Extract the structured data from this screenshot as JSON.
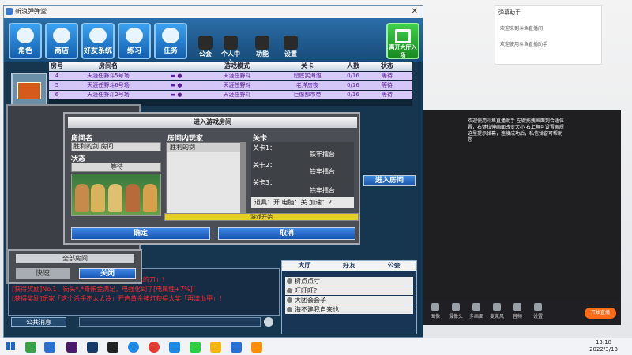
{
  "window": {
    "title": "新浪弹弹堂"
  },
  "toolbar": {
    "character": "角色",
    "shop": "商店",
    "friends": "好友系统",
    "practice": "练习",
    "tasks": "任务",
    "guild": "公会",
    "personal": "个人中心",
    "features": "功能",
    "settings": "设置",
    "exit": "离开大厅入场"
  },
  "room_list": {
    "headers": [
      "房号",
      "房间名",
      "游戏模式",
      "关卡",
      "人数",
      "状态"
    ],
    "rows": [
      {
        "no": "4",
        "name": "天涯任野斗5号场",
        "mode": "天涯任野斗",
        "stage": "窟底实海滩",
        "count": "0/16",
        "status": "等待"
      },
      {
        "no": "5",
        "name": "天涯任野斗6号场",
        "mode": "天涯任野斗",
        "stage": "老洋房夜",
        "count": "0/16",
        "status": "等待"
      },
      {
        "no": "6",
        "name": "天涯任野斗2号场",
        "mode": "天涯任野斗",
        "stage": "巨像都市帝",
        "count": "0/16",
        "status": "等待"
      }
    ]
  },
  "dialog": {
    "title": "进入游戏房间",
    "room_name_label": "房间名",
    "room_name_value": "胜利的剑 房间",
    "status_label": "状态",
    "status_value": "等待",
    "players_label": "房间内玩家",
    "players": [
      "胜利的剑"
    ],
    "stage_label": "关卡",
    "stages": [
      {
        "name": "关卡1：",
        "value": "铁牢擂台"
      },
      {
        "name": "关卡2：",
        "value": "铁牢擂台"
      },
      {
        "name": "关卡3：",
        "value": "铁牢擂台"
      }
    ],
    "props": "道具：开 电脑：关 加速：2",
    "loading": "游戏开始",
    "confirm": "确定",
    "cancel": "取消"
  },
  "enter_room": "进入房间",
  "small_dialog": {
    "top": "全部房间",
    "left": "快速",
    "right": "关闭"
  },
  "chat": {
    "lines": [
      "[获得奖励]玩家「天涯...」获得大奖「黄金血色的刀」！",
      "[获得奖励]No.1，街头*,*奇贿金满足，电强化到了[电属性+7%]！",
      "[获得奖励]玩家「这个杀手不太太冷」开启黄金神灯获得大奖「再津血甲」！"
    ],
    "channel": "公共消息"
  },
  "side_list": {
    "tabs": [
      "大厅",
      "好友",
      "公会"
    ],
    "items": [
      "树点点寸",
      "旺旺旺?",
      "大团会会子",
      "海不建我自来也"
    ]
  },
  "notify": {
    "title": "弹幕助手",
    "text1": "欢迎来到斗鱼直播间",
    "text2": "欢迎使用斗鱼直播助手"
  },
  "stream": {
    "text": "欢迎使用斗鱼直播助手 左键拖拽画面到合适位置，右键拉伸画面改变大小 右上角可设置画质 这里提示弹幕，连接成功后，私信弹窗可帮助您",
    "tools": [
      "图像",
      "摄像头",
      "多画面",
      "麦克风",
      "音频",
      "设置"
    ],
    "start": "开始直播"
  },
  "taskbar": {
    "time": "13:18",
    "date": "2022/3/13"
  }
}
